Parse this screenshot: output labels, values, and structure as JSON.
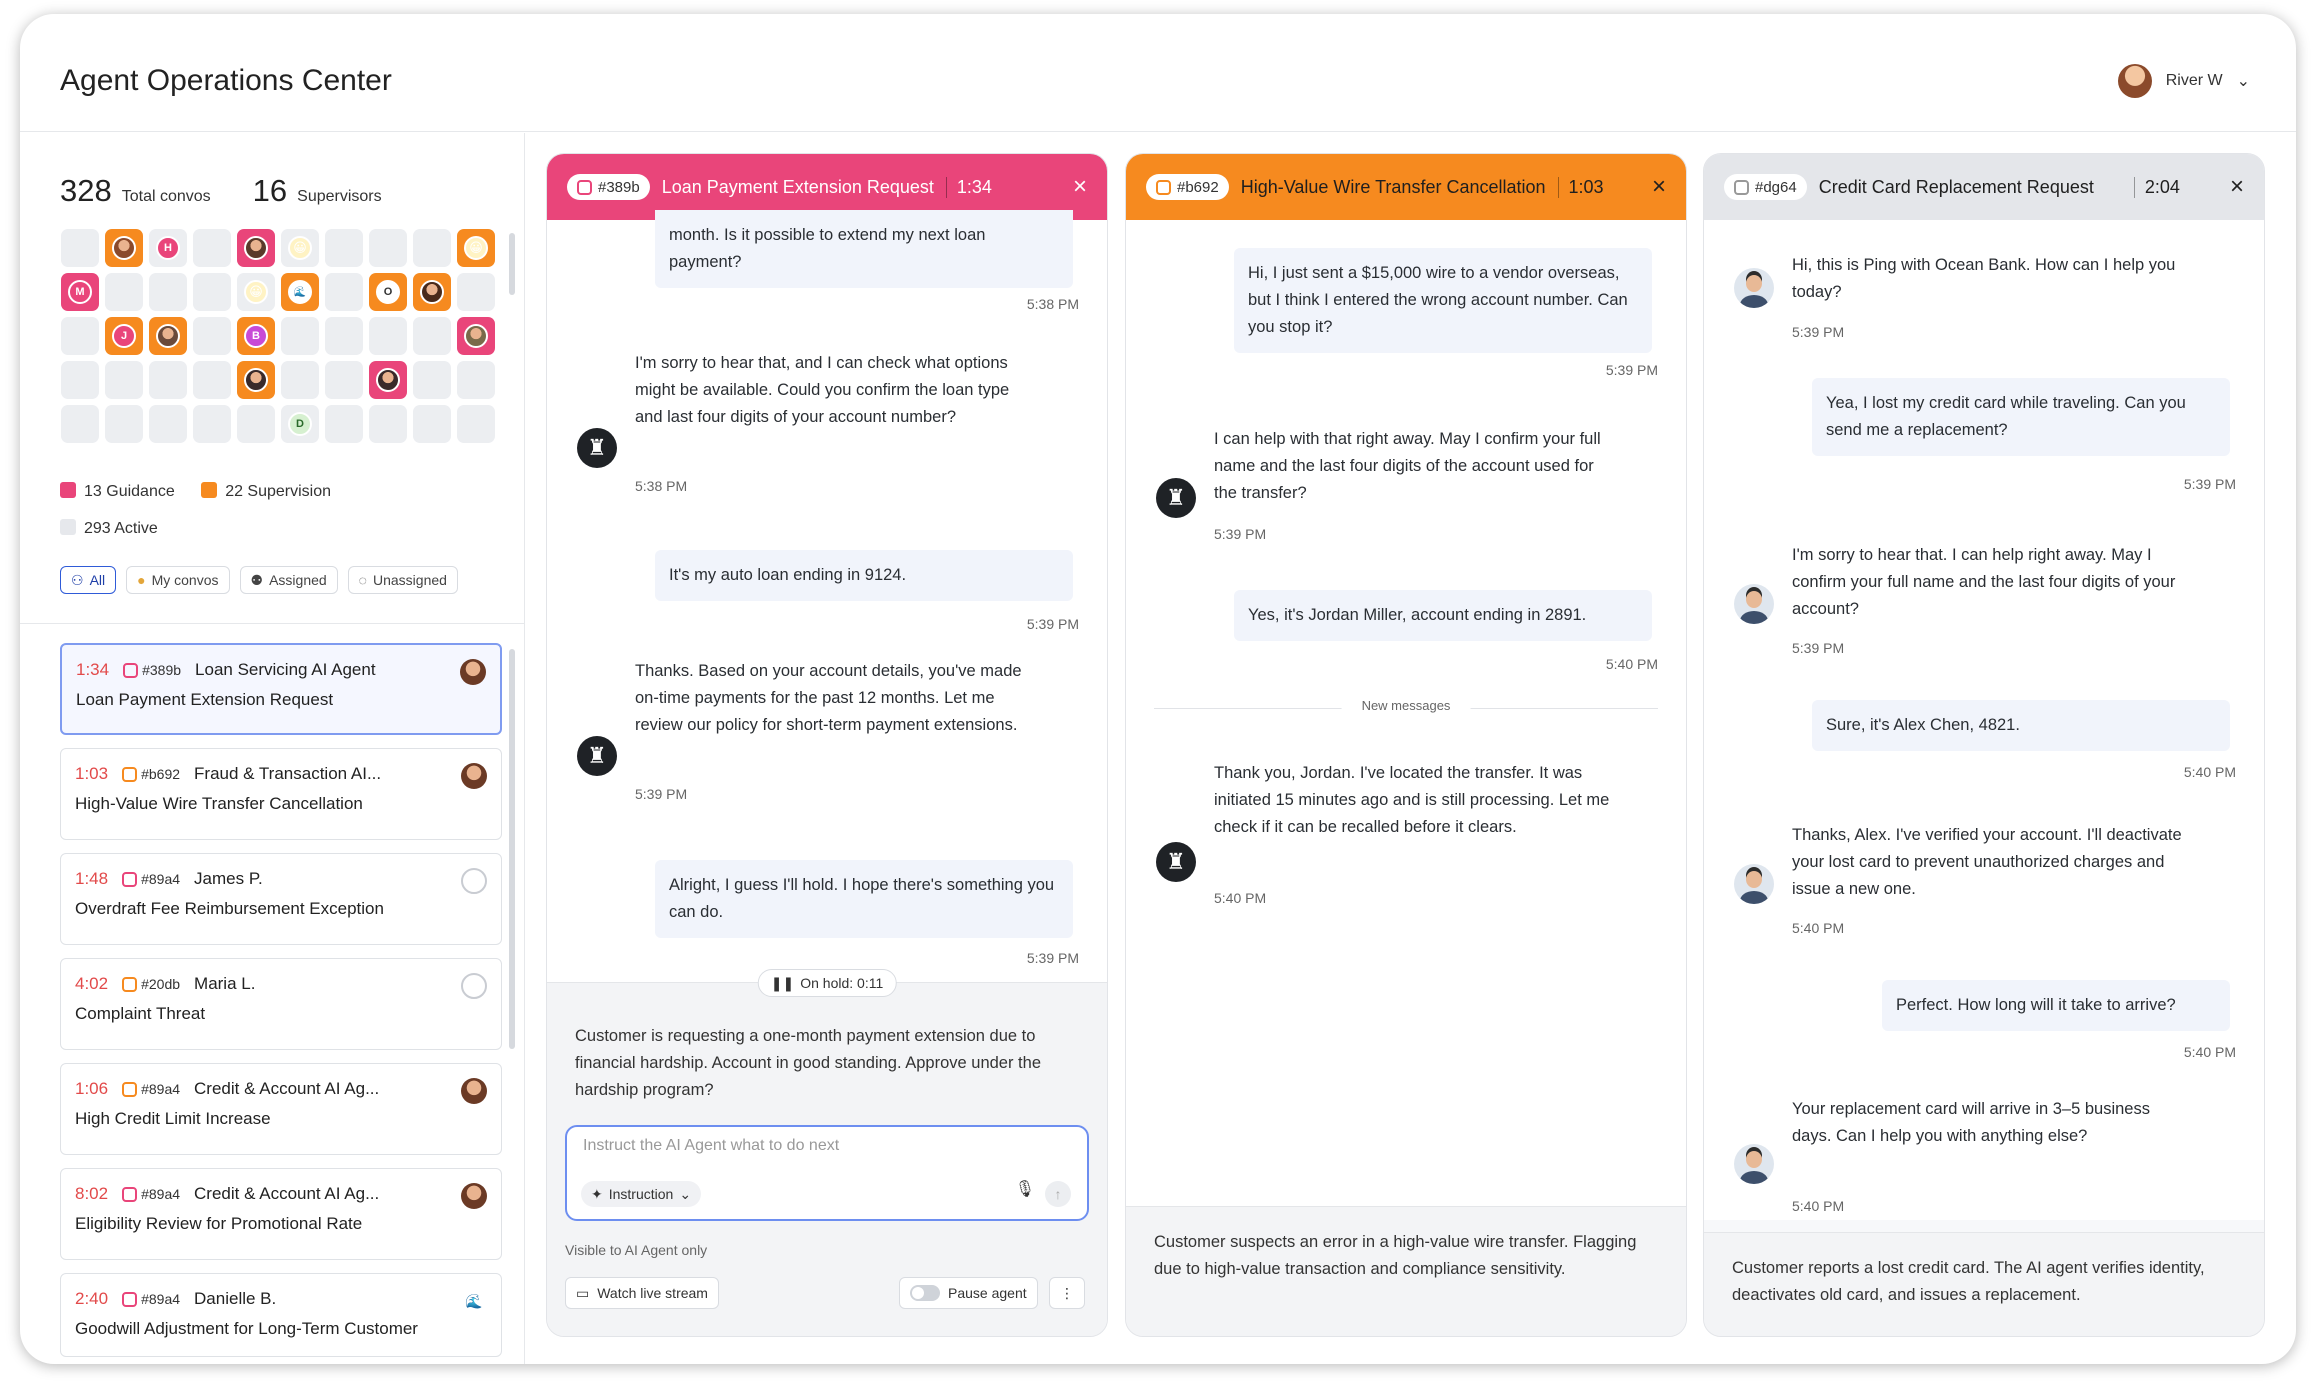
{
  "app": {
    "title": "Agent Operations Center"
  },
  "user": {
    "name": "River W"
  },
  "stats": {
    "total_convos": "328",
    "total_convos_label": "Total convos",
    "supervisors": "16",
    "supervisors_label": "Supervisors"
  },
  "grid_letters": {
    "h": "H",
    "m": "M",
    "j": "J",
    "b": "B",
    "o": "O",
    "d": "D"
  },
  "legend": {
    "guidance": "13 Guidance",
    "supervision": "22 Supervision",
    "active": "293 Active"
  },
  "filters": [
    "All",
    "My convos",
    "Assigned",
    "Unassigned"
  ],
  "convo_list": [
    {
      "time": "1:34",
      "id": "#389b",
      "agent": "Loan Servicing AI Agent",
      "title": "Loan Payment Extension Request"
    },
    {
      "time": "1:03",
      "id": "#b692",
      "agent": "Fraud & Transaction AI...",
      "title": "High-Value Wire Transfer Cancellation"
    },
    {
      "time": "1:48",
      "id": "#89a4",
      "agent": "James P.",
      "title": "Overdraft Fee Reimbursement Exception"
    },
    {
      "time": "4:02",
      "id": "#20db",
      "agent": "Maria L.",
      "title": "Complaint Threat"
    },
    {
      "time": "1:06",
      "id": "#89a4",
      "agent": "Credit & Account AI Ag...",
      "title": "High Credit Limit Increase"
    },
    {
      "time": "8:02",
      "id": "#89a4",
      "agent": "Credit & Account AI Ag...",
      "title": "Eligibility Review for Promotional Rate"
    },
    {
      "time": "2:40",
      "id": "#89a4",
      "agent": "Danielle B.",
      "title": "Goodwill Adjustment for Long-Term Customer"
    }
  ],
  "panels": [
    {
      "id": "#389b",
      "title": "Loan Payment Extension Request",
      "timer": "1:34",
      "header_color": "#e9457a",
      "messages": [
        {
          "text": "month. Is it possible to extend my next loan payment?",
          "time": "5:38 PM"
        },
        {
          "text": "I'm sorry to hear that, and I can check what options might be available. Could you confirm the loan type and last four digits of your account number?",
          "time": "5:38 PM"
        },
        {
          "text": "It's my auto loan ending in 9124.",
          "time": "5:39 PM"
        },
        {
          "text": "Thanks. Based on your account details, you've made on-time payments for the past 12 months. Let me review our policy for short-term payment extensions.",
          "time": "5:39 PM"
        },
        {
          "text": "Alright, I guess I'll hold. I hope there's something you can do.",
          "time": "5:39 PM"
        }
      ],
      "on_hold": "On hold: 0:11",
      "summary": "Customer is requesting a one-month payment extension due to financial hardship. Account in good standing. Approve under the hardship program?",
      "input_placeholder": "Instruct the AI Agent what to do next",
      "instruction_label": "Instruction",
      "visible_note": "Visible to AI Agent only",
      "watch_label": "Watch live stream",
      "pause_label": "Pause agent"
    },
    {
      "id": "#b692",
      "title": "High-Value Wire Transfer Cancellation",
      "timer": "1:03",
      "header_color": "#f68a1f",
      "messages": [
        {
          "text": "Hi, I just sent a $15,000 wire to a vendor overseas, but I think I entered the wrong account number. Can you stop it?",
          "time": "5:39 PM"
        },
        {
          "text": "I can help with that right away. May I confirm your full name and the last four digits of the account used for the transfer?",
          "time": "5:39 PM"
        },
        {
          "text": "Yes, it's Jordan Miller, account ending in 2891.",
          "time": "5:40 PM"
        },
        {
          "text": "Thank you, Jordan. I've located the transfer. It was initiated 15 minutes ago and is still processing. Let me check if it can be recalled before it clears.",
          "time": "5:40 PM"
        }
      ],
      "new_messages": "New messages",
      "summary": "Customer suspects an error in a high-value wire transfer. Flagging due to high-value transaction and compliance sensitivity."
    },
    {
      "id": "#dg64",
      "title": "Credit Card Replacement Request",
      "timer": "2:04",
      "header_color": "#e4e6ea",
      "messages": [
        {
          "text": "Hi, this is Ping with Ocean Bank. How can I help you today?",
          "time": "5:39 PM"
        },
        {
          "text": "Yea, I lost my credit card while traveling. Can you send me a replacement?",
          "time": "5:39 PM"
        },
        {
          "text": "I'm sorry to hear that. I can help right away. May I confirm your full name and the last four digits of your account?",
          "time": "5:39 PM"
        },
        {
          "text": "Sure, it's Alex Chen, 4821.",
          "time": "5:40 PM"
        },
        {
          "text": "Thanks, Alex. I've verified your account. I'll deactivate your lost card to prevent unauthorized charges and issue a new one.",
          "time": "5:40 PM"
        },
        {
          "text": "Perfect. How long will it take to arrive?",
          "time": "5:40 PM"
        },
        {
          "text": "Your replacement card will arrive in 3–5 business days. Can I help you with anything else?",
          "time": "5:40 PM"
        }
      ],
      "summary": "Customer reports a lost credit card. The AI agent verifies identity, deactivates old card, and issues a replacement."
    }
  ],
  "icons": {
    "close": "close-icon",
    "bot": "bot-icon",
    "mic": "mic-icon",
    "send": "send-arrow-icon",
    "pause": "pause-icon",
    "chevron": "chevron-down-icon"
  }
}
